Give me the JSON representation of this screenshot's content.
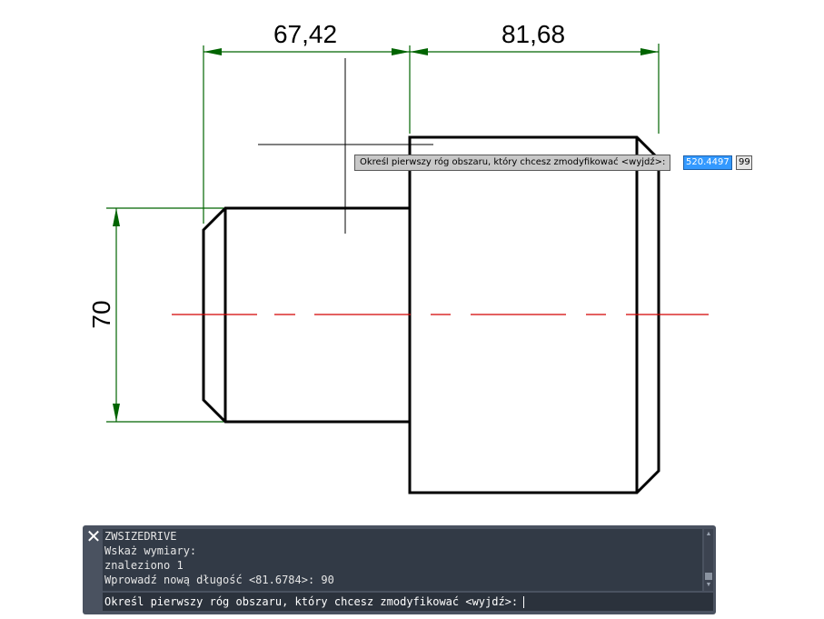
{
  "dimensions": {
    "top_left": "67,42",
    "top_right": "81,68",
    "left_vertical": "70"
  },
  "dynamic_input": {
    "prompt": "Określ pierwszy róg obszaru, który chcesz zmodyfikować <wyjdź>:",
    "x_value": "520.4497",
    "y_value": "99"
  },
  "command_line": {
    "close_icon": "close-icon",
    "history": [
      "ZWSIZEDRIVE",
      "Wskaż wymiary:",
      "znaleziono 1",
      "Wprowadź nową długość <81.6784>: 90"
    ],
    "prompt": "Określ pierwszy róg obszaru, który chcesz zmodyfikować <wyjdź>:"
  },
  "colors": {
    "dimension": "#006400",
    "centerline": "#d40000",
    "geometry": "#000000",
    "panel": "#4a5260",
    "highlight": "#3399ff"
  }
}
